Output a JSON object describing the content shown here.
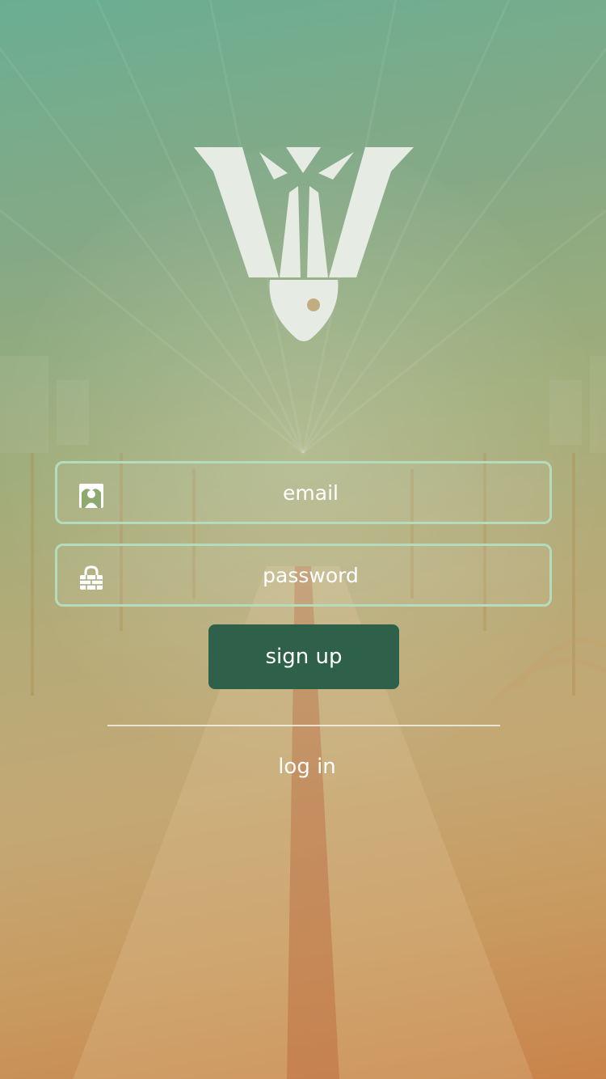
{
  "form": {
    "email_placeholder": "email",
    "password_placeholder": "password",
    "signup_label": "sign up",
    "login_label": "log in"
  },
  "icons": {
    "logo": "fish-w-logo",
    "email": "user-icon",
    "password": "lock-icon"
  },
  "colors": {
    "field_border": "#b4dcbc",
    "button_bg": "#2f6049",
    "text": "#ffffff",
    "logo": "#e6ebe4"
  }
}
